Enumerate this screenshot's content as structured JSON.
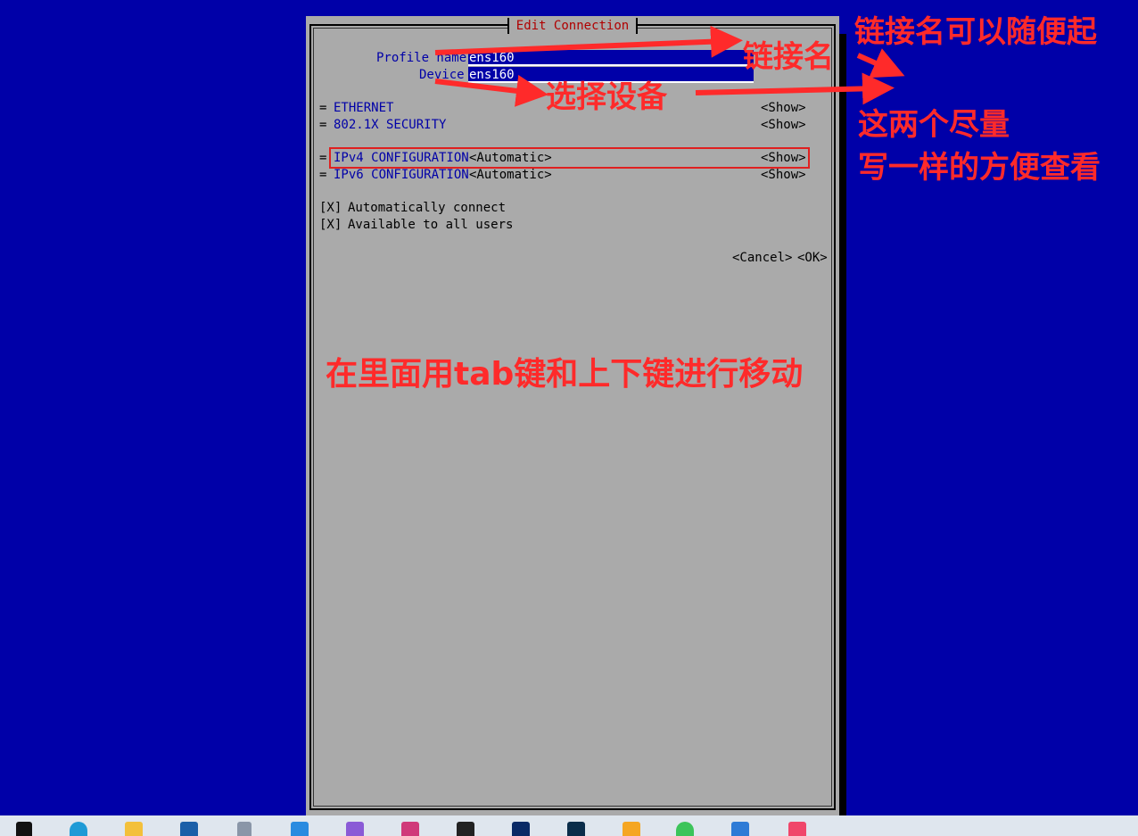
{
  "dialog": {
    "title": "Edit Connection",
    "profile_label": "Profile name",
    "profile_value": "ens160",
    "device_label": "Device",
    "device_value": "ens160",
    "sections": [
      {
        "prefix": "=",
        "label": "ETHERNET",
        "mode": "",
        "action": "<Show>"
      },
      {
        "prefix": "=",
        "label": "802.1X SECURITY",
        "mode": "",
        "action": "<Show>"
      },
      {
        "prefix": "=",
        "label": "IPv4 CONFIGURATION",
        "mode": "<Automatic>",
        "action": "<Show>"
      },
      {
        "prefix": "=",
        "label": "IPv6 CONFIGURATION",
        "mode": "<Automatic>",
        "action": "<Show>"
      }
    ],
    "checkboxes": [
      {
        "mark": "[X]",
        "label": "Automatically connect"
      },
      {
        "mark": "[X]",
        "label": "Available to all users"
      }
    ],
    "cancel_label": "<Cancel>",
    "ok_label": "<OK>"
  },
  "annotations": {
    "link_name": "链接名",
    "link_name_free": "链接名可以随便起",
    "select_device": "选择设备",
    "same_line1": "这两个尽量",
    "same_line2": "写一样的方便查看",
    "tab_hint": "在里面用tab键和上下键进行移动"
  },
  "colors": {
    "background": "#0000a8",
    "dialog": "#aaaaaa",
    "annotation": "#ff2a2a",
    "title": "#b00000"
  },
  "taskbar": {
    "icons": [
      "windows-start-icon",
      "edge-icon",
      "file-explorer-icon",
      "store-icon",
      "app-icon",
      "vscode-icon",
      "visual-studio-icon",
      "intellij-icon",
      "terminal-icon",
      "photoshop-icon",
      "lightroom-icon",
      "app-orange-icon",
      "wechat-icon",
      "photos-icon",
      "music-icon"
    ]
  }
}
